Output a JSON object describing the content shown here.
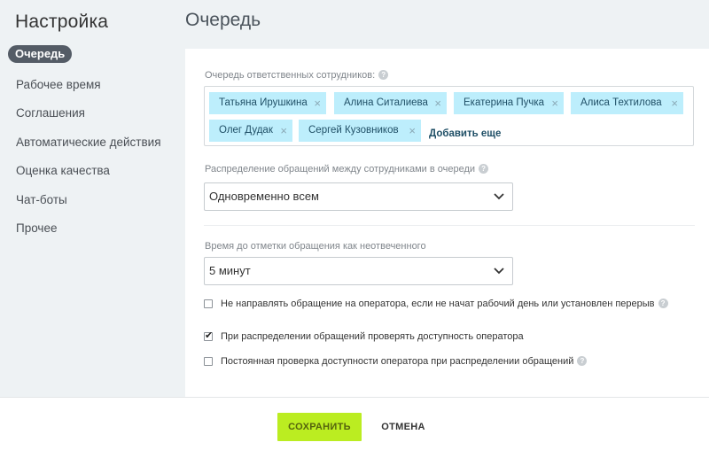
{
  "sidebar": {
    "title": "Настройка",
    "items": [
      {
        "label": "Очередь",
        "active": true
      },
      {
        "label": "Рабочее время"
      },
      {
        "label": "Соглашения"
      },
      {
        "label": "Автоматические действия"
      },
      {
        "label": "Оценка качества"
      },
      {
        "label": "Чат-боты"
      },
      {
        "label": "Прочее"
      }
    ]
  },
  "main": {
    "title": "Очередь",
    "queue": {
      "label": "Очередь ответственных сотрудников:",
      "employees": [
        "Татьяна Ирушкина",
        "Алина Ситалиева",
        "Екатерина Пучка",
        "Алиса Техтилова",
        "Олег Дудак",
        "Сергей Кузовников"
      ],
      "remove_glyph": "×",
      "add_more": "Добавить еще"
    },
    "distribution": {
      "label": "Распределение обращений между сотрудниками в очереди",
      "value": "Одновременно всем"
    },
    "unanswered": {
      "label": "Время до отметки обращения как неотвеченного",
      "value": "5 минут"
    },
    "options": [
      {
        "label": "Не направлять обращение на оператора, если не начат рабочий день или установлен перерыв",
        "checked": false,
        "help": true
      },
      {
        "label": "При распределении обращений проверять доступность оператора",
        "checked": true,
        "help": false
      },
      {
        "label": "Постоянная проверка доступности оператора при распределении обращений",
        "checked": false,
        "help": true
      }
    ],
    "help_glyph": "?",
    "check_glyph": "✔"
  },
  "footer": {
    "save_label": "СОХРАНИТЬ",
    "cancel_label": "ОТМЕНА"
  },
  "colors": {
    "accent_save": "#bbed21",
    "tag_background": "#bdeefc",
    "active_pill": "#545c66",
    "page_background": "#eef2f4"
  }
}
